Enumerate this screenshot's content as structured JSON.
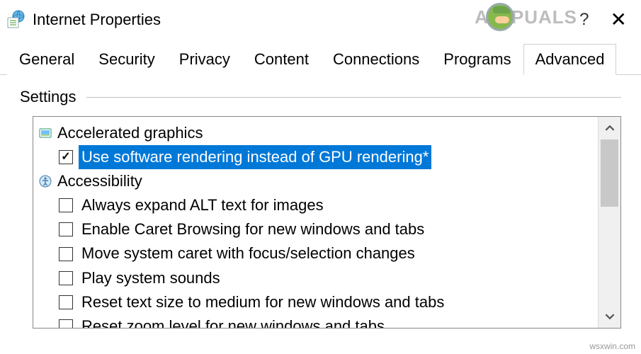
{
  "window": {
    "title": "Internet Properties"
  },
  "watermark": {
    "text_a": "A",
    "text_b": "PUALS"
  },
  "tabs": [
    {
      "label": "General",
      "active": false
    },
    {
      "label": "Security",
      "active": false
    },
    {
      "label": "Privacy",
      "active": false
    },
    {
      "label": "Content",
      "active": false
    },
    {
      "label": "Connections",
      "active": false
    },
    {
      "label": "Programs",
      "active": false
    },
    {
      "label": "Advanced",
      "active": true
    }
  ],
  "section": {
    "label": "Settings"
  },
  "groups": {
    "g0": {
      "label": "Accelerated graphics"
    },
    "g1": {
      "label": "Accessibility"
    }
  },
  "items": {
    "i0": {
      "label": "Use software rendering instead of GPU rendering*",
      "checked": true,
      "selected": true
    },
    "i1": {
      "label": "Always expand ALT text for images",
      "checked": false
    },
    "i2": {
      "label": "Enable Caret Browsing for new windows and tabs",
      "checked": false
    },
    "i3": {
      "label": "Move system caret with focus/selection changes",
      "checked": false
    },
    "i4": {
      "label": "Play system sounds",
      "checked": false
    },
    "i5": {
      "label": "Reset text size to medium for new windows and tabs",
      "checked": false
    },
    "i6": {
      "label": "Reset zoom level for new windows and tabs",
      "checked": false
    }
  },
  "footer": {
    "source": "wsxwin.com"
  }
}
